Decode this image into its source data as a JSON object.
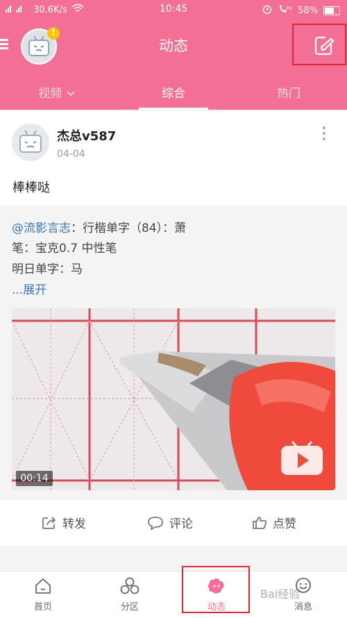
{
  "status_bar": {
    "signal": "4G",
    "speed": "30.6K/s",
    "time": "10:45",
    "battery": "58%"
  },
  "header": {
    "title": "动态",
    "badge": "!",
    "tabs": [
      {
        "label": "视频",
        "dropdown": true
      },
      {
        "label": "综合",
        "active": true
      },
      {
        "label": "热门"
      }
    ]
  },
  "post": {
    "username": "杰总v587",
    "date": "04-04",
    "text": "棒棒哒",
    "repost": {
      "mention": "@流影言志",
      "line1_rest": "：行楷单字（84）：萧",
      "line2": "笔：宝克0.7 中性笔",
      "line3": "明日单字：马",
      "expand": "...展开",
      "video_duration": "00:14"
    },
    "actions": {
      "share": "转发",
      "comment": "评论",
      "like": "点赞"
    }
  },
  "bottom_nav": [
    {
      "label": "首页",
      "icon": "home-icon"
    },
    {
      "label": "分区",
      "icon": "category-icon"
    },
    {
      "label": "动态",
      "icon": "dynamic-icon",
      "active": true
    },
    {
      "label": "消息",
      "icon": "message-icon"
    }
  ],
  "watermark": "Bai经验",
  "colors": {
    "accent": "#f46f95",
    "highlight_box": "#e1262d",
    "link": "#3a76b8"
  }
}
